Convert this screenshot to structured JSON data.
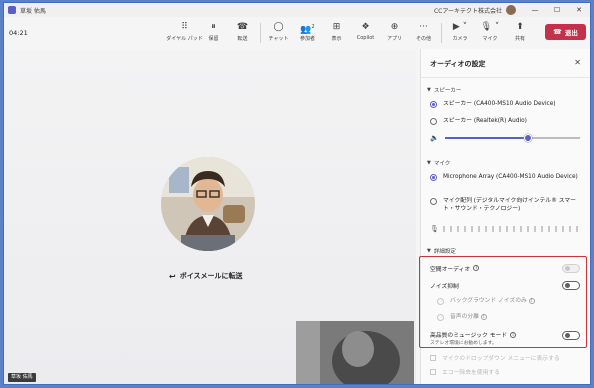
{
  "window": {
    "title": "草坂 佑馬",
    "organization": "CCアーキテクト株式会社",
    "min": "—",
    "max": "☐",
    "close": "✕"
  },
  "toolbar": {
    "timer": "04:21",
    "dialpad_label": "ダイヤル パッド",
    "hold_label": "保留",
    "transfer_label": "転送",
    "chat_label": "チャット",
    "people_label": "参加者",
    "people_count": "2",
    "view_label": "表示",
    "copilot_label": "Copilot",
    "apps_label": "アプリ",
    "more_label": "その他",
    "camera_label": "カメラ",
    "mic_label": "マイク",
    "share_label": "共有",
    "end_label": "退出"
  },
  "stage": {
    "voicemail_label": "ボイスメールに転送",
    "self_name": "草坂 佑馬"
  },
  "panel": {
    "title": "オーディオの設定",
    "speaker_section": "スピーカー",
    "speaker_options": [
      {
        "label": "スピーカー (CA400-MS10 Audio Device)",
        "selected": true
      },
      {
        "label": "スピーカー (Realtek(R) Audio)",
        "selected": false
      }
    ],
    "speaker_volume": 0.6,
    "mic_section": "マイク",
    "mic_options": [
      {
        "label": "Microphone Array (CA400-MS10 Audio Device)",
        "selected": true
      },
      {
        "label": "マイク配列 (デジタルマイク向けインテル® スマート・サウンド・テクノロジー)",
        "selected": false
      }
    ],
    "advanced_section": "詳細設定",
    "spatial_audio": "空間オーディオ",
    "noise_suppression": "ノイズ抑制",
    "bg_noise_only": "バックグラウンド ノイズのみ",
    "voice_isolation": "音声の分離",
    "hq_music_mode": "高品質のミュージック モード",
    "hq_music_sub": "ステレオ環境にお勧めします。",
    "mic_dropdown_hint": "マイクのドロップダウン メニューに表示する",
    "echo_cancel": "エコー除去を使用する"
  }
}
